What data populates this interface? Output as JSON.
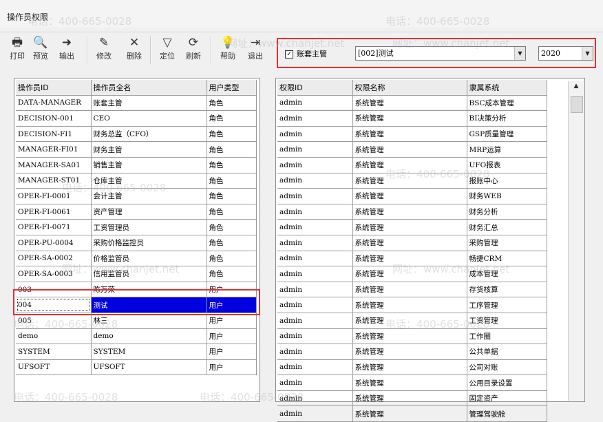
{
  "window": {
    "title": "操作员权限"
  },
  "toolbar": [
    {
      "icon": "print-icon",
      "label": "打印"
    },
    {
      "icon": "preview-icon",
      "label": "预览"
    },
    {
      "icon": "export-icon",
      "label": "输出"
    },
    {
      "icon": "edit-icon",
      "label": "修改"
    },
    {
      "icon": "delete-icon",
      "label": "删除"
    },
    {
      "icon": "filter-icon",
      "label": "定位"
    },
    {
      "icon": "refresh-icon",
      "label": "刷新"
    },
    {
      "icon": "help-icon",
      "label": "帮助"
    },
    {
      "icon": "exit-icon",
      "label": "退出"
    }
  ],
  "filter": {
    "checkbox_label": "账套主管",
    "checked": true,
    "account": "[002]测试",
    "year": "2020"
  },
  "users": {
    "headers": [
      "操作员ID",
      "操作员全名",
      "用户类型"
    ],
    "rows": [
      [
        "DATA-MANAGER",
        "账套主管",
        "角色"
      ],
      [
        "DECISION-001",
        "CEO",
        "角色"
      ],
      [
        "DECISION-FI1",
        "财务总监（CFO）",
        "角色"
      ],
      [
        "MANAGER-FI01",
        "财务主管",
        "角色"
      ],
      [
        "MANAGER-SA01",
        "销售主管",
        "角色"
      ],
      [
        "MANAGER-ST01",
        "仓库主管",
        "角色"
      ],
      [
        "OPER-FI-0001",
        "会计主管",
        "角色"
      ],
      [
        "OPER-FI-0061",
        "资产管理",
        "角色"
      ],
      [
        "OPER-FI-0071",
        "工资管理员",
        "角色"
      ],
      [
        "OPER-PU-0004",
        "采购价格监控员",
        "角色"
      ],
      [
        "OPER-SA-0002",
        "价格监管员",
        "角色"
      ],
      [
        "OPER-SA-0003",
        "信用监管员",
        "角色"
      ],
      [
        "003",
        "陈万荣",
        "用户"
      ],
      [
        "004",
        "测试",
        "用户"
      ],
      [
        "005",
        "林三",
        "用户"
      ],
      [
        "demo",
        "demo",
        "用户"
      ],
      [
        "SYSTEM",
        "SYSTEM",
        "用户"
      ],
      [
        "UFSOFT",
        "UFSOFT",
        "用户"
      ]
    ],
    "selected_index": 13
  },
  "perms": {
    "headers": [
      "权限ID",
      "权限名称",
      "隶属系统"
    ],
    "rows": [
      [
        "admin",
        "系统管理",
        "BSC成本管理"
      ],
      [
        "admin",
        "系统管理",
        "BI决策分析"
      ],
      [
        "admin",
        "系统管理",
        "GSP质量管理"
      ],
      [
        "admin",
        "系统管理",
        "MRP运算"
      ],
      [
        "admin",
        "系统管理",
        "UFO报表"
      ],
      [
        "admin",
        "系统管理",
        "报账中心"
      ],
      [
        "admin",
        "系统管理",
        "财务WEB"
      ],
      [
        "admin",
        "系统管理",
        "财务分析"
      ],
      [
        "admin",
        "系统管理",
        "财务汇总"
      ],
      [
        "admin",
        "系统管理",
        "采购管理"
      ],
      [
        "admin",
        "系统管理",
        "畅捷CRM"
      ],
      [
        "admin",
        "系统管理",
        "成本管理"
      ],
      [
        "admin",
        "系统管理",
        "存货核算"
      ],
      [
        "admin",
        "系统管理",
        "工序管理"
      ],
      [
        "admin",
        "系统管理",
        "工资管理"
      ],
      [
        "admin",
        "系统管理",
        "工作圈"
      ],
      [
        "admin",
        "系统管理",
        "公共单据"
      ],
      [
        "admin",
        "系统管理",
        "公司对账"
      ],
      [
        "admin",
        "系统管理",
        "公用目录设置"
      ],
      [
        "admin",
        "系统管理",
        "固定资产"
      ],
      [
        "admin",
        "系统管理",
        "管理驾驶舱"
      ]
    ]
  },
  "watermarks": [
    "电话：400-665-0028",
    "网址：www.chanjet.net"
  ]
}
